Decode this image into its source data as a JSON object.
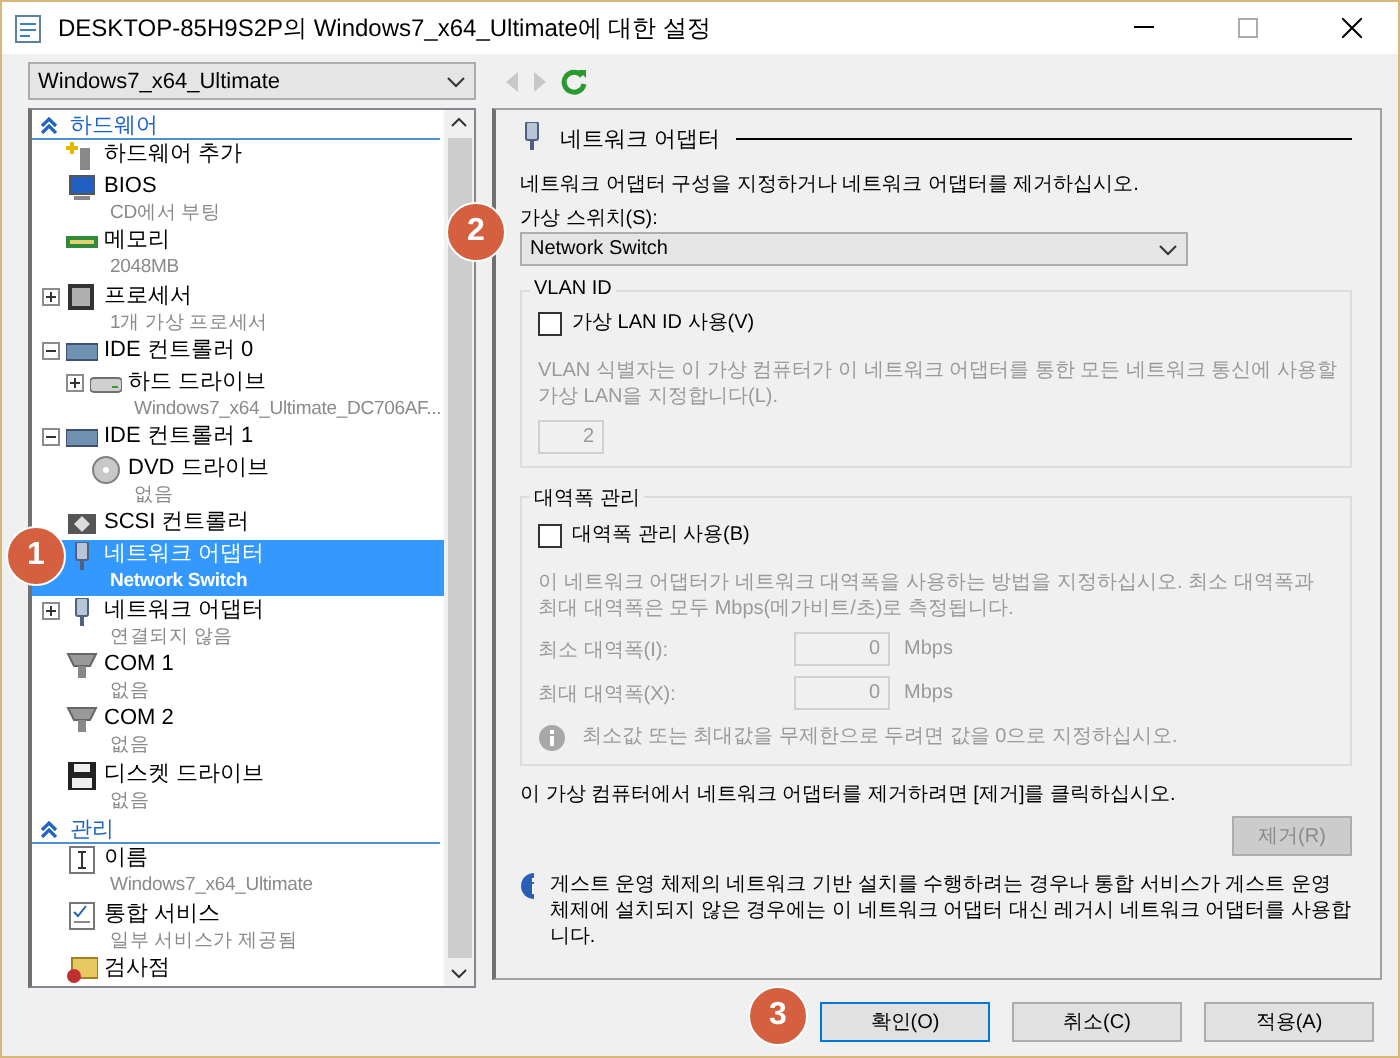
{
  "window": {
    "title": "DESKTOP-85H9S2P의 Windows7_x64_Ultimate에 대한 설정"
  },
  "vm_select": {
    "value": "Windows7_x64_Ultimate"
  },
  "tree": [
    {
      "kind": "section",
      "label": "하드웨어",
      "expanded": true,
      "children": [
        {
          "kind": "item",
          "label": "하드웨어 추가",
          "selected": false
        },
        {
          "kind": "item",
          "label": "BIOS",
          "detail": "CD에서 부팅",
          "selected": false
        },
        {
          "kind": "item",
          "label": "메모리",
          "detail": "2048MB",
          "selected": false
        },
        {
          "kind": "item",
          "label": "프로세서",
          "detail": "1개 가상 프로세서",
          "expanded": false,
          "selected": false
        },
        {
          "kind": "item",
          "label": "IDE 컨트롤러 0",
          "expanded": true,
          "selected": false,
          "children": [
            {
              "kind": "item",
              "label": "하드 드라이브",
              "detail": "Windows7_x64_Ultimate_DC706AF...",
              "expanded": false,
              "selected": false
            }
          ]
        },
        {
          "kind": "item",
          "label": "IDE 컨트롤러 1",
          "expanded": true,
          "selected": false,
          "children": [
            {
              "kind": "item",
              "label": "DVD 드라이브",
              "detail": "없음",
              "selected": false
            }
          ]
        },
        {
          "kind": "item",
          "label": "SCSI 컨트롤러",
          "selected": false
        },
        {
          "kind": "item",
          "label": "네트워크 어댑터",
          "detail": "Network Switch",
          "selected": true
        },
        {
          "kind": "item",
          "label": "네트워크 어댑터",
          "detail": "연결되지 않음",
          "expanded": false,
          "selected": false
        },
        {
          "kind": "item",
          "label": "COM 1",
          "detail": "없음",
          "selected": false
        },
        {
          "kind": "item",
          "label": "COM 2",
          "detail": "없음",
          "selected": false
        },
        {
          "kind": "item",
          "label": "디스켓 드라이브",
          "detail": "없음",
          "selected": false
        }
      ]
    },
    {
      "kind": "section",
      "label": "관리",
      "expanded": true,
      "children": [
        {
          "kind": "item",
          "label": "이름",
          "detail": "Windows7_x64_Ultimate",
          "selected": false
        },
        {
          "kind": "item",
          "label": "통합 서비스",
          "detail": "일부 서비스가 제공됨",
          "selected": false
        },
        {
          "kind": "item",
          "label": "검사점",
          "selected": false
        }
      ]
    }
  ],
  "detail": {
    "heading": "네트워크 어댑터",
    "intro": "네트워크 어댑터 구성을 지정하거나 네트워크 어댑터를 제거하십시오.",
    "switch_label": "가상 스위치(S):",
    "switch_value": "Network Switch",
    "vlan": {
      "title": "VLAN ID",
      "checkbox": {
        "label": "가상 LAN ID 사용(V)",
        "checked": false
      },
      "description": "VLAN 식별자는 이 가상 컴퓨터가 이 네트워크 어댑터를 통한 모든 네트워크 통신에 사용할 가상 LAN을 지정합니다(L).",
      "value": "2",
      "disabled": true
    },
    "bandwidth": {
      "title": "대역폭 관리",
      "checkbox": {
        "label": "대역폭 관리 사용(B)",
        "checked": false
      },
      "description": "이 네트워크 어댑터가 네트워크 대역폭을 사용하는 방법을 지정하십시오. 최소 대역폭과 최대 대역폭은 모두 Mbps(메가비트/초)로 측정됩니다.",
      "disabled": true,
      "fields": [
        {
          "label": "최소 대역폭(I):",
          "value": "0",
          "unit": "Mbps"
        },
        {
          "label": "최대 대역폭(X):",
          "value": "0",
          "unit": "Mbps"
        }
      ],
      "note": "최소값 또는 최대값을 무제한으로 두려면 값을 0으로 지정하십시오."
    },
    "remove_text": "이 가상 컴퓨터에서 네트워크 어댑터를 제거하려면 [제거]를 클릭하십시오.",
    "remove_button": {
      "label": "제거(R)",
      "disabled": true
    },
    "info": "게스트 운영 체제의 네트워크 기반 설치를 수행하려는 경우나 통합 서비스가 게스트 운영 체제에 설치되지 않은 경우에는 이 네트워크 어댑터 대신 레거시 네트워크 어댑터를 사용합니다."
  },
  "buttons": [
    {
      "label": "확인(O)",
      "default": true
    },
    {
      "label": "취소(C)",
      "default": false
    },
    {
      "label": "적용(A)",
      "default": false
    }
  ],
  "callouts": [
    {
      "label": "1"
    },
    {
      "label": "2"
    },
    {
      "label": "3"
    }
  ]
}
